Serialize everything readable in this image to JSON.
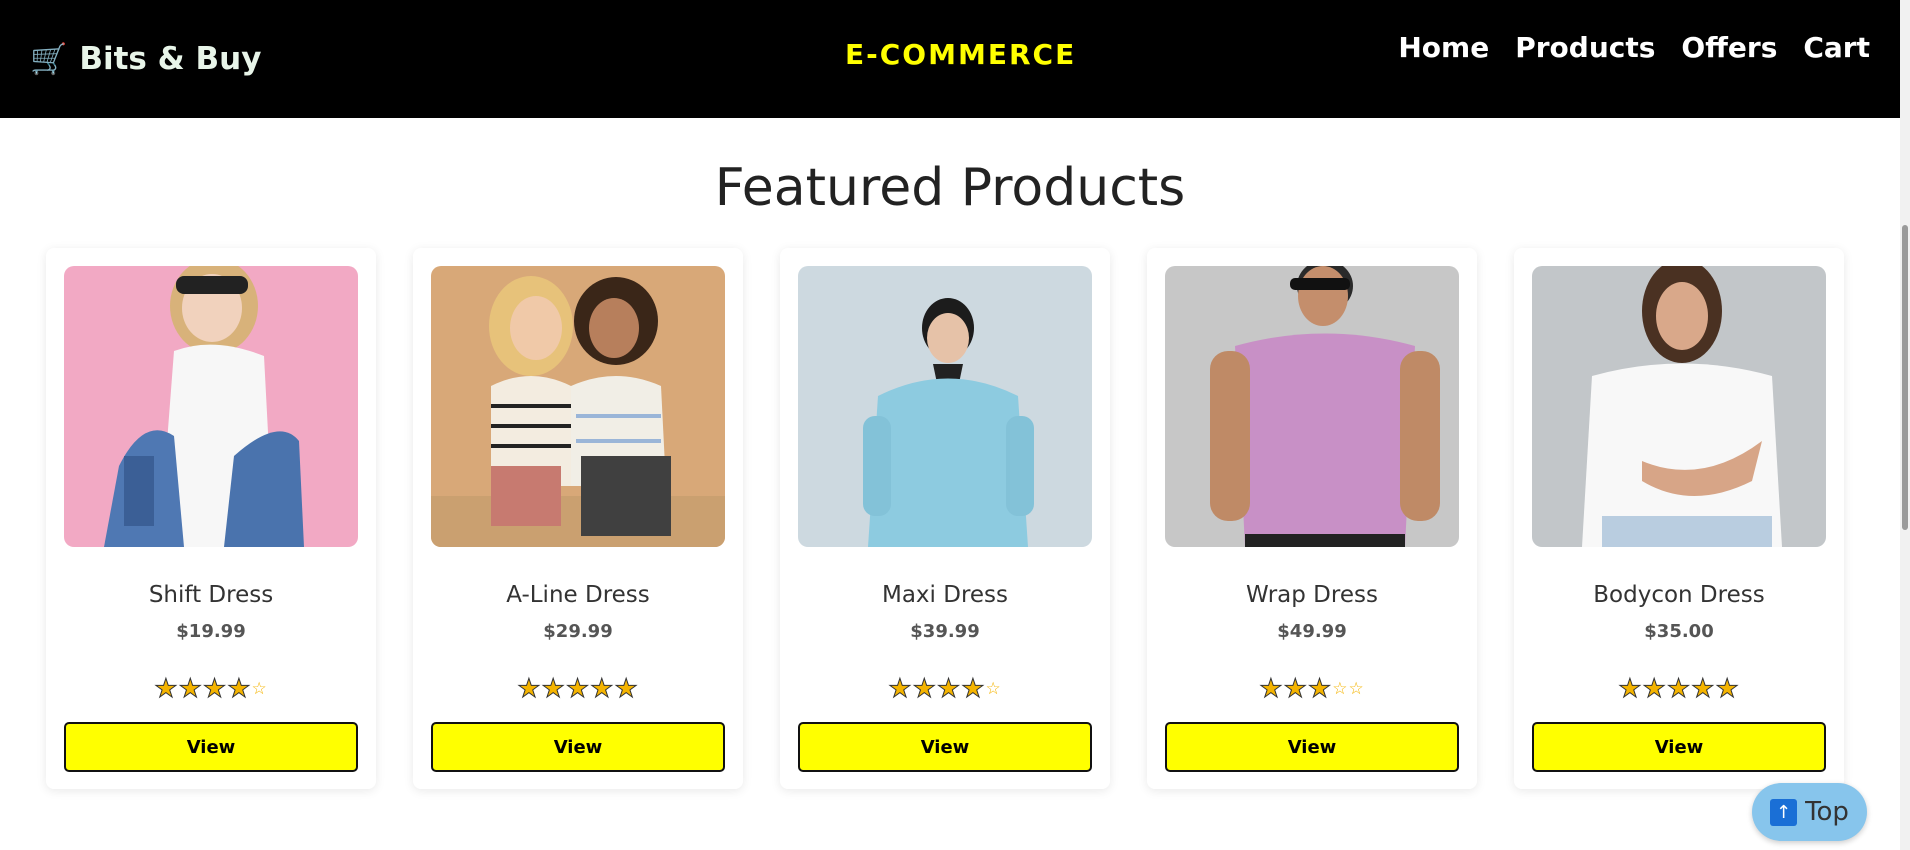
{
  "header": {
    "brand_icon": "🛒",
    "brand_name": "Bits & Buy",
    "site_name": "E-COMMERCE",
    "nav": [
      "Home",
      "Products",
      "Offers",
      "Cart"
    ]
  },
  "section_title": "Featured Products",
  "products": [
    {
      "name": "Shift Dress",
      "price": "$19.99",
      "rating": 4,
      "button": "View"
    },
    {
      "name": "A-Line Dress",
      "price": "$29.99",
      "rating": 5,
      "button": "View"
    },
    {
      "name": "Maxi Dress",
      "price": "$39.99",
      "rating": 4,
      "button": "View"
    },
    {
      "name": "Wrap Dress",
      "price": "$49.99",
      "rating": 3,
      "button": "View"
    },
    {
      "name": "Bodycon Dress",
      "price": "$35.00",
      "rating": 5,
      "button": "View"
    }
  ],
  "back_to_top": {
    "icon": "up-arrow-icon",
    "label": "Top"
  },
  "colors": {
    "accent": "#ffff00",
    "nav_bg": "#000000",
    "top_button": "#87c5ec"
  }
}
